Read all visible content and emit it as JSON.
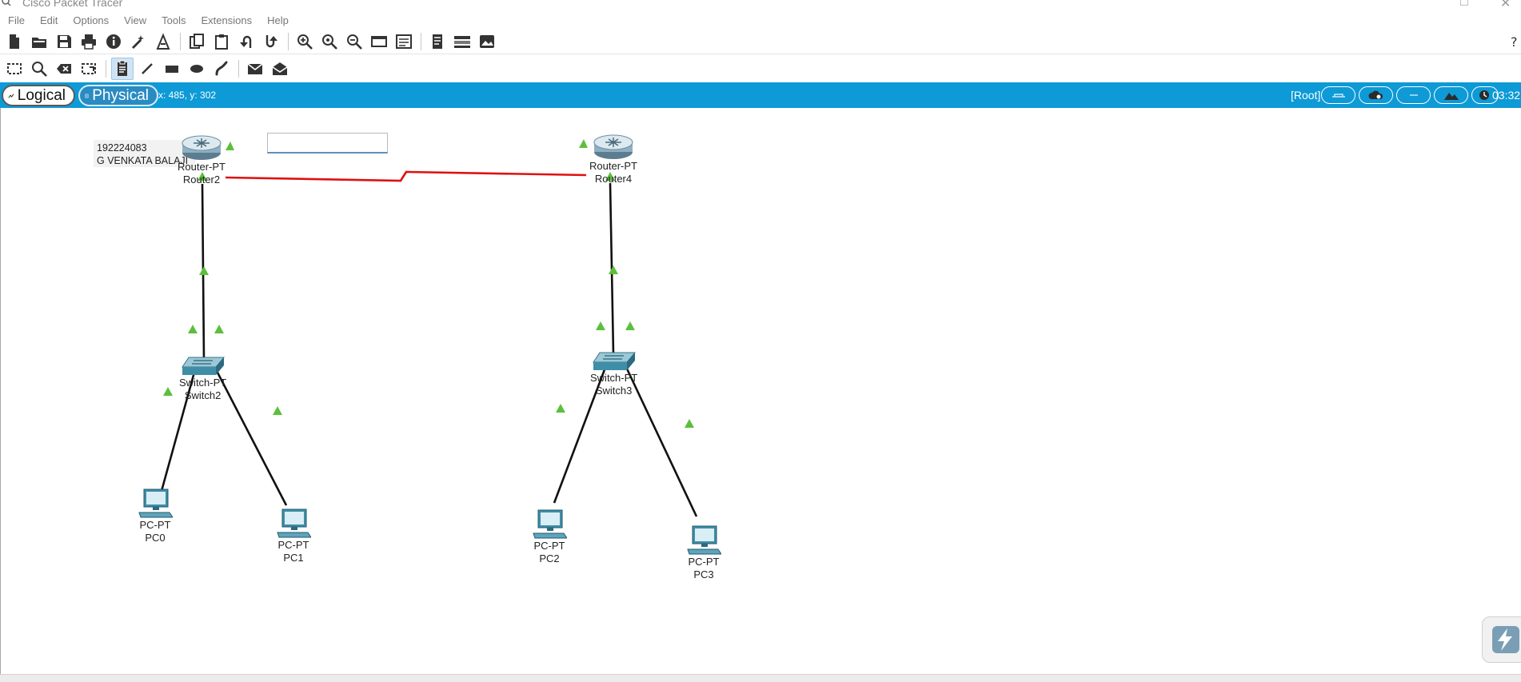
{
  "window": {
    "title": "Cisco Packet Tracer"
  },
  "menu": [
    "File",
    "Edit",
    "Options",
    "View",
    "Tools",
    "Extensions",
    "Help"
  ],
  "toolbar1": [
    {
      "name": "new-file-icon"
    },
    {
      "name": "open-folder-icon"
    },
    {
      "name": "save-icon"
    },
    {
      "name": "print-icon"
    },
    {
      "name": "info-icon"
    },
    {
      "name": "activity-wizard-icon"
    },
    {
      "name": "custom-devices-icon"
    },
    {
      "name": "copy-icon"
    },
    {
      "name": "paste-icon"
    },
    {
      "name": "undo-icon"
    },
    {
      "name": "redo-icon"
    },
    {
      "name": "zoom-in-icon"
    },
    {
      "name": "zoom-reset-icon"
    },
    {
      "name": "zoom-out-icon"
    },
    {
      "name": "drawing-palette-icon"
    },
    {
      "name": "custom-device-dialog-icon"
    },
    {
      "name": "viewport-icon"
    },
    {
      "name": "network-info-icon"
    },
    {
      "name": "image-icon"
    }
  ],
  "toolbar2": [
    {
      "name": "select-icon"
    },
    {
      "name": "inspect-icon"
    },
    {
      "name": "delete-icon"
    },
    {
      "name": "resize-shape-icon"
    },
    {
      "name": "place-note-icon",
      "active": true
    },
    {
      "name": "draw-line-icon"
    },
    {
      "name": "draw-rectangle-icon"
    },
    {
      "name": "draw-ellipse-icon"
    },
    {
      "name": "freeform-icon"
    },
    {
      "name": "simple-pdu-icon"
    },
    {
      "name": "complex-pdu-icon"
    }
  ],
  "modebar": {
    "logical_label": "Logical",
    "physical_label": "Physical",
    "coords": "x: 485, y: 302",
    "root_label": "[Root]",
    "clock": "03:32:"
  },
  "colors": {
    "mode_bar": "#0d9ad6",
    "serial_link": "#e01010",
    "ethernet_link": "#111111",
    "port_up": "#5cbf3c",
    "device_body": "#3f8ea8"
  },
  "workspace": {
    "note": {
      "line1": "192224083",
      "line2": "G VENKATA BALAJI"
    },
    "text_input_value": "",
    "devices": [
      {
        "id": "router2",
        "type": "router",
        "model": "Router-PT",
        "name": "Router2"
      },
      {
        "id": "router4",
        "type": "router",
        "model": "Router-PT",
        "name": "Router4"
      },
      {
        "id": "switch2",
        "type": "switch",
        "model": "Switch-PT",
        "name": "Switch2"
      },
      {
        "id": "switch3",
        "type": "switch",
        "model": "Switch-PT",
        "name": "Switch3"
      },
      {
        "id": "pc0",
        "type": "pc",
        "model": "PC-PT",
        "name": "PC0"
      },
      {
        "id": "pc1",
        "type": "pc",
        "model": "PC-PT",
        "name": "PC1"
      },
      {
        "id": "pc2",
        "type": "pc",
        "model": "PC-PT",
        "name": "PC2"
      },
      {
        "id": "pc3",
        "type": "pc",
        "model": "PC-PT",
        "name": "PC3"
      }
    ],
    "links": [
      {
        "from": "router2",
        "to": "router4",
        "kind": "serial"
      },
      {
        "from": "router2",
        "to": "switch2",
        "kind": "ethernet"
      },
      {
        "from": "router4",
        "to": "switch3",
        "kind": "ethernet"
      },
      {
        "from": "switch2",
        "to": "pc0",
        "kind": "ethernet"
      },
      {
        "from": "switch2",
        "to": "pc1",
        "kind": "ethernet"
      },
      {
        "from": "switch3",
        "to": "pc2",
        "kind": "ethernet"
      },
      {
        "from": "switch3",
        "to": "pc3",
        "kind": "ethernet"
      }
    ]
  }
}
